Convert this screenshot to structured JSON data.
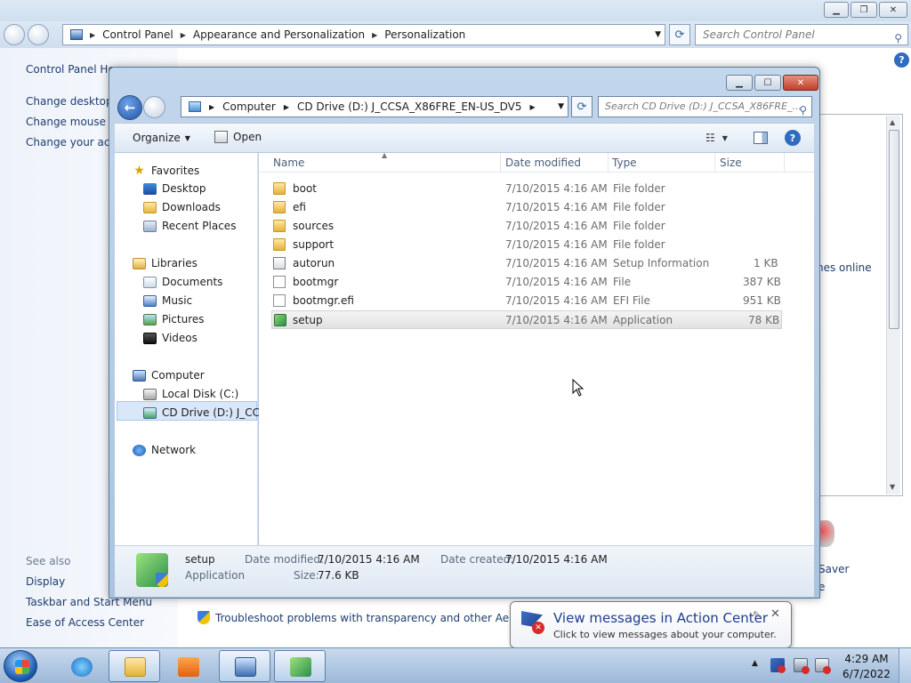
{
  "control_panel": {
    "breadcrumb": [
      "Control Panel",
      "Appearance and Personalization",
      "Personalization"
    ],
    "search_placeholder": "Search Control Panel",
    "left_links": [
      "Control Panel Ho",
      "Change desktop i",
      "Change mouse po",
      "Change your acco"
    ],
    "see_also_label": "See also",
    "see_also": [
      "Display",
      "Taskbar and Start Menu",
      "Ease of Access Center"
    ],
    "themes_online": "nes online",
    "saver_label": "Saver",
    "saver_label2": "e",
    "troubleshoot": "Troubleshoot problems with transparency and other Aero effe"
  },
  "explorer": {
    "breadcrumb": [
      "Computer",
      "CD Drive (D:) J_CCSA_X86FRE_EN-US_DV5"
    ],
    "search_placeholder": "Search CD Drive (D:) J_CCSA_X86FRE_...",
    "toolbar": {
      "organize": "Organize",
      "open": "Open"
    },
    "nav": {
      "favorites": "Favorites",
      "favorites_items": [
        "Desktop",
        "Downloads",
        "Recent Places"
      ],
      "libraries": "Libraries",
      "libraries_items": [
        "Documents",
        "Music",
        "Pictures",
        "Videos"
      ],
      "computer": "Computer",
      "computer_items": [
        "Local Disk (C:)",
        "CD Drive (D:) J_CCSA"
      ],
      "network": "Network"
    },
    "columns": [
      "Name",
      "Date modified",
      "Type",
      "Size"
    ],
    "files": [
      {
        "name": "boot",
        "date": "7/10/2015 4:16 AM",
        "type": "File folder",
        "size": ""
      },
      {
        "name": "efi",
        "date": "7/10/2015 4:16 AM",
        "type": "File folder",
        "size": ""
      },
      {
        "name": "sources",
        "date": "7/10/2015 4:16 AM",
        "type": "File folder",
        "size": ""
      },
      {
        "name": "support",
        "date": "7/10/2015 4:16 AM",
        "type": "File folder",
        "size": ""
      },
      {
        "name": "autorun",
        "date": "7/10/2015 4:16 AM",
        "type": "Setup Information",
        "size": "1 KB"
      },
      {
        "name": "bootmgr",
        "date": "7/10/2015 4:16 AM",
        "type": "File",
        "size": "387 KB"
      },
      {
        "name": "bootmgr.efi",
        "date": "7/10/2015 4:16 AM",
        "type": "EFI File",
        "size": "951 KB"
      },
      {
        "name": "setup",
        "date": "7/10/2015 4:16 AM",
        "type": "Application",
        "size": "78 KB"
      }
    ],
    "details": {
      "name": "setup",
      "kind": "Application",
      "date_modified_label": "Date modified:",
      "date_modified": "7/10/2015 4:16 AM",
      "date_created_label": "Date created:",
      "date_created": "7/10/2015 4:16 AM",
      "size_label": "Size:",
      "size": "77.6 KB"
    }
  },
  "balloon": {
    "title": "View messages in Action Center",
    "subtitle": "Click to view messages about your computer."
  },
  "taskbar": {
    "time": "4:29 AM",
    "date": "6/7/2022"
  },
  "colors": {
    "accent": "#2f6cbf",
    "link": "#1e3d6e",
    "selection": "#d9e7f8",
    "close_button": "#c0402a",
    "balloon_title": "#1e3d8c"
  },
  "icons": {
    "search": "search-icon",
    "help": "help-icon",
    "back": "back-arrow-icon",
    "forward": "forward-arrow-icon",
    "refresh": "refresh-icon",
    "folder": "folder-icon",
    "application": "setup-app-icon",
    "action_center": "action-center-flag-icon"
  }
}
